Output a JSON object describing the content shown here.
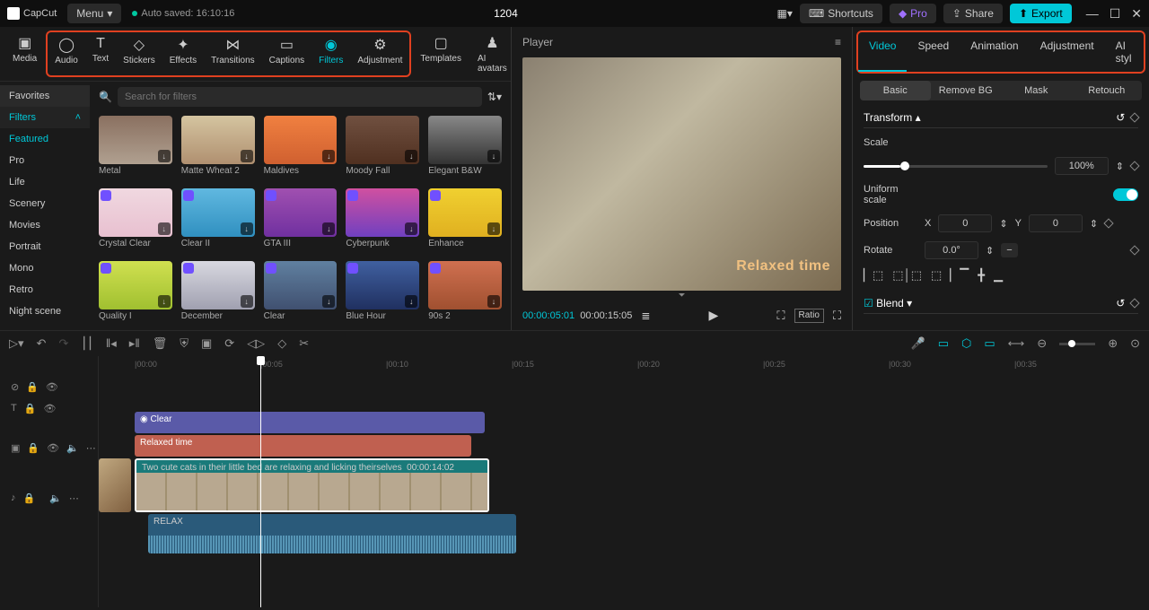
{
  "titlebar": {
    "app": "CapCut",
    "menu": "Menu",
    "autosave": "Auto saved: 16:10:16",
    "project": "1204",
    "shortcuts": "Shortcuts",
    "pro": "Pro",
    "share": "Share",
    "export": "Export"
  },
  "tooltabs": {
    "media": "Media",
    "audio": "Audio",
    "text": "Text",
    "stickers": "Stickers",
    "effects": "Effects",
    "transitions": "Transitions",
    "captions": "Captions",
    "filters": "Filters",
    "adjustment": "Adjustment",
    "templates": "Templates",
    "ai": "AI avatars"
  },
  "categories": {
    "favorites": "Favorites",
    "filters": "Filters",
    "featured": "Featured",
    "pro": "Pro",
    "life": "Life",
    "scenery": "Scenery",
    "movies": "Movies",
    "portrait": "Portrait",
    "mono": "Mono",
    "retro": "Retro",
    "night": "Night scene"
  },
  "search": {
    "placeholder": "Search for filters"
  },
  "filters": [
    {
      "name": "Metal",
      "bg": "linear-gradient(#8a7060,#b0a090)"
    },
    {
      "name": "Matte Wheat 2",
      "bg": "linear-gradient(#d4c4a0,#b09070)"
    },
    {
      "name": "Maldives",
      "bg": "linear-gradient(#f08040,#d06030)"
    },
    {
      "name": "Moody Fall",
      "bg": "linear-gradient(#705040,#503020)"
    },
    {
      "name": "Elegant B&W",
      "bg": "linear-gradient(#888,#333)"
    },
    {
      "name": "Crystal Clear",
      "bg": "linear-gradient(#f0d8e0,#e8c0d0)"
    },
    {
      "name": "Clear II",
      "bg": "linear-gradient(#60b8e0,#3090c0)"
    },
    {
      "name": "GTA III",
      "bg": "linear-gradient(#a050b0,#7030a0)"
    },
    {
      "name": "Cyberpunk",
      "bg": "linear-gradient(#d050a0,#7040c0)"
    },
    {
      "name": "Enhance",
      "bg": "linear-gradient(#f0d030,#e0b020)"
    },
    {
      "name": "Quality I",
      "bg": "linear-gradient(#d0e050,#a0c030)"
    },
    {
      "name": "December",
      "bg": "linear-gradient(#d8d8e0,#a0a0b0)"
    },
    {
      "name": "Clear",
      "bg": "linear-gradient(#6080a0,#405070)"
    },
    {
      "name": "Blue Hour",
      "bg": "linear-gradient(#4060a0,#203060)"
    },
    {
      "name": "90s 2",
      "bg": "linear-gradient(#d07050,#a05030)"
    }
  ],
  "player": {
    "title": "Player",
    "overlay": "Relaxed time",
    "current": "00:00:05:01",
    "total": "00:00:15:05",
    "ratio": "Ratio"
  },
  "rp": {
    "tabs": {
      "video": "Video",
      "speed": "Speed",
      "animation": "Animation",
      "adjustment": "Adjustment",
      "ai": "AI styl"
    },
    "sub": {
      "basic": "Basic",
      "removebg": "Remove BG",
      "mask": "Mask",
      "retouch": "Retouch"
    },
    "transform": "Transform",
    "scale": "Scale",
    "scale_val": "100%",
    "uniform": "Uniform scale",
    "position": "Position",
    "posx": "X",
    "posx_val": "0",
    "posy": "Y",
    "posy_val": "0",
    "rotate": "Rotate",
    "rotate_val": "0.0°",
    "blend": "Blend"
  },
  "timeline": {
    "ticks": [
      "00:00",
      "00:05",
      "00:10",
      "00:15",
      "00:20",
      "00:25",
      "00:30",
      "00:35"
    ],
    "filter_clip": "Clear",
    "text_clip": "Relaxed time",
    "video_clip": "Two cute cats in their little bed are relaxing and licking theirselves",
    "video_dur": "00:00:14:02",
    "audio_clip": "RELAX"
  }
}
